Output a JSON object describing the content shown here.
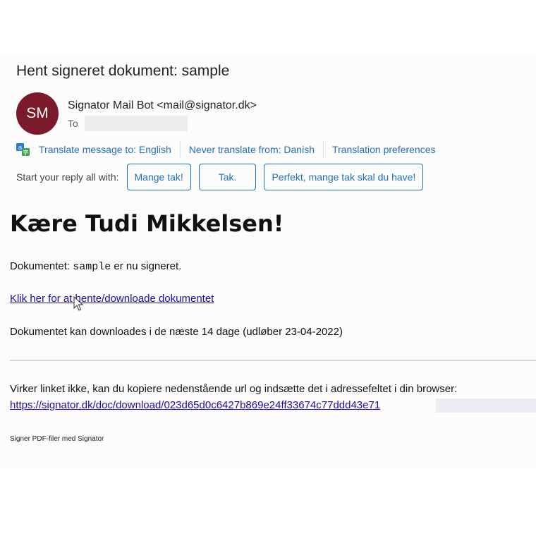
{
  "email": {
    "subject": "Hent signeret dokument: sample",
    "avatar_initials": "SM",
    "avatar_color": "#7a1a2a",
    "sender": "Signator Mail Bot <mail@signator.dk>",
    "to_label": "To"
  },
  "translation_bar": {
    "icon": "translate-icon",
    "translate_link": "Translate message to: English",
    "never_translate_link": "Never translate from: Danish",
    "preferences_link": "Translation preferences"
  },
  "quick_reply": {
    "label": "Start your reply all with:",
    "suggestions": [
      "Mange tak!",
      "Tak.",
      "Perfekt, mange tak skal du have!"
    ]
  },
  "body": {
    "greeting": "Kære Tudi Mikkelsen!",
    "doc_line_prefix": "Dokumentet: ",
    "doc_name": "sample",
    "doc_line_suffix": " er nu signeret.",
    "download_link": "Klik her for at hente/downloade dokumentet",
    "expiry_text": "Dokumentet kan downloades i de næste 14 dage (udløber 23-04-2022)",
    "fallback_text": "Virker linket ikke, kan du kopiere nedenstående url og indsætte det i adressefeltet i din browser:",
    "download_url": "https://signator.dk/doc/download/023d65d0c6427b869e24ff33674c77ddd43e71",
    "footer": "Signer PDF-filer med Signator"
  },
  "colors": {
    "link_blue": "#1f6fbf",
    "body_link": "#1a0dab"
  }
}
